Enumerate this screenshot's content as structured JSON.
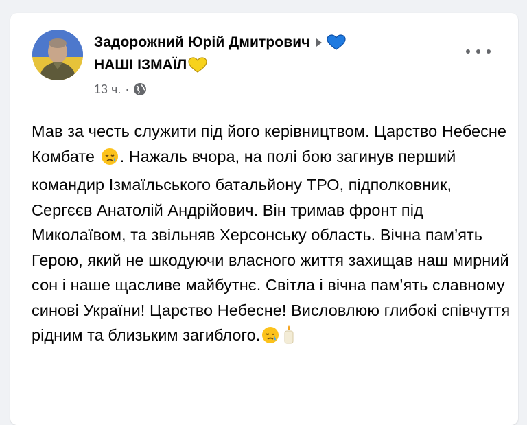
{
  "post": {
    "author_name": "Задорожний Юрій Дмитрович",
    "group_name": "НАШІ ІЗМАЇЛ",
    "timestamp": "13 ч.",
    "separator": "·",
    "privacy_icon": "globe-icon",
    "menu_icon": "more-options-icon",
    "body": {
      "seg1": "Мав за честь служити під його керівництвом. Царство Небесне Комбате ",
      "seg2": ". Нажаль вчора, на полі бою загинув перший командир Ізмаїльського батальйону ТРО, підполковник, Сергєєв Анатолій Андрійович. Він тримав фронт під Миколаївом, та звільняв Херсонську область. Вічна пам’ять Герою, який не шкодуючи власного життя захищав наш мирний сон і наше щасливе майбутнє. Світла і вічна пам’ять славному синові України! Царство Небесне! Висловлюю глибокі співчуття рідним та близьким загиблого.",
      "emojis": [
        "crying-face-emoji",
        "crying-face-emoji",
        "candle-emoji"
      ]
    }
  },
  "colors": {
    "background": "#f0f2f5",
    "card": "#ffffff",
    "text_primary": "#050505",
    "text_secondary": "#65676b",
    "blue_heart": "#1f7ae0",
    "yellow_heart": "#f7d21c"
  }
}
